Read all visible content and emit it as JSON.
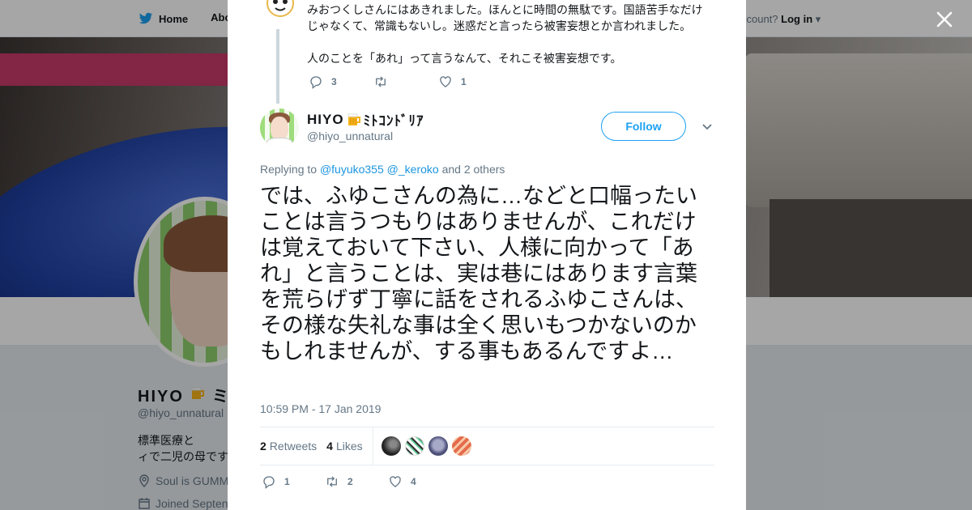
{
  "header": {
    "home_label": "Home",
    "about_label": "Abo",
    "account_prompt": "ccount?",
    "login_label": "Log in"
  },
  "profile": {
    "name": "HIYO",
    "name_suffix": "ミ",
    "handle": "@hiyo_unnatural",
    "bio_line1": "標準医療と",
    "bio_line2": "ィで二児の母です",
    "location": "Soul is GUMM",
    "joined": "Joined Septen"
  },
  "previous_tweet": {
    "text_line": "みおつくしさんにはあきれました。ほんとに時間の無駄です。国語苦手なだけじゃなくて、常識もないし。迷惑だと言ったら被害妄想とか言われました。",
    "text_line2": "人のことを「あれ」って言うなんて、それこそ被害妄想です。",
    "reply_count": "3",
    "retweet_count": "",
    "like_count": "1"
  },
  "tweet": {
    "author_name": "HIYO",
    "author_suffix": "ﾐﾄｺﾝﾄﾞﾘｱ",
    "author_handle": "@hiyo_unnatural",
    "follow_label": "Follow",
    "replying_prefix": "Replying to",
    "mention1": "@fuyuko355",
    "mention2": "@_keroko",
    "replying_suffix": "and 2 others",
    "text": "では、ふゆこさんの為に…などと口幅ったいことは言うつもりはありませんが、これだけは覚えておいて下さい、人様に向かって「あれ」と言うことは、実は巷にはあります言葉を荒らげず丁寧に話をされるふゆこさんは、その様な失礼な事は全く思いもつかないのかもしれませんが、する事もあるんですよ…",
    "timestamp": "10:59 PM - 17 Jan 2019",
    "retweets_count": "2",
    "retweets_label": "Retweets",
    "likes_count": "4",
    "likes_label": "Likes",
    "reply_count": "1",
    "retweet_count": "2",
    "like_count": "4"
  },
  "icons": [
    "twitter-bird-icon",
    "close-icon",
    "reply-icon",
    "retweet-icon",
    "heart-icon",
    "chevron-down-icon",
    "location-icon",
    "calendar-icon",
    "beer-icon"
  ],
  "colors": {
    "accent": "#1da1f2",
    "link": "#1b95e0",
    "text": "#14171a",
    "muted": "#657786"
  }
}
